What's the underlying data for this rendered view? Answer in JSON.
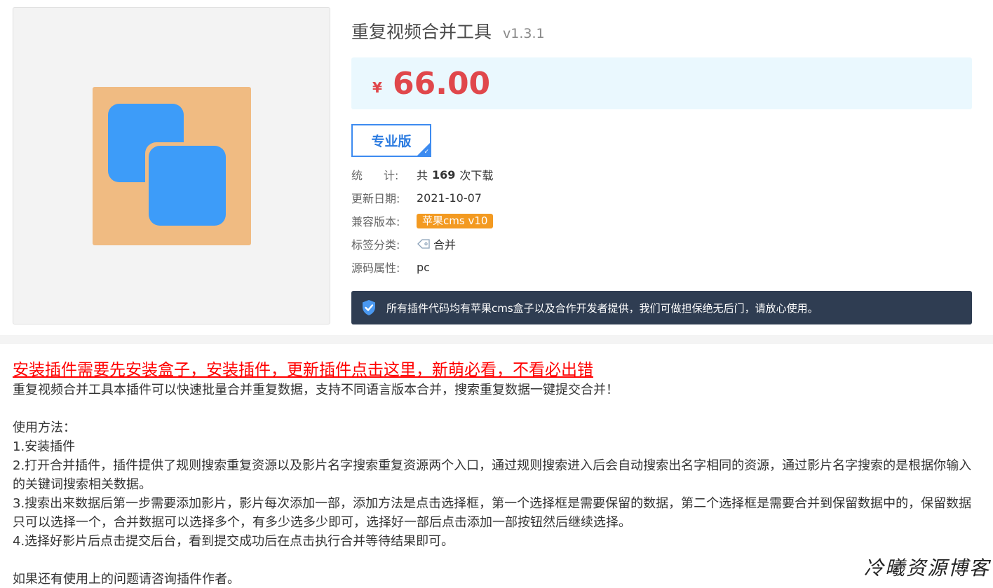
{
  "product": {
    "title": "重复视频合并工具",
    "version": "v1.3.1",
    "currency": "¥",
    "price": "66.00",
    "edition": "专业版",
    "stats": {
      "label_a": "统",
      "label_b": "计:",
      "prefix": "共",
      "count": "169",
      "suffix": "次下载"
    },
    "update_date": {
      "label": "更新日期:",
      "value": "2021-10-07"
    },
    "compat": {
      "label": "兼容版本:",
      "value": "苹果cms v10"
    },
    "tags": {
      "label": "标签分类:",
      "value": "合并"
    },
    "source": {
      "label": "源码属性:",
      "value": "pc"
    },
    "guarantee": "所有插件代码均有苹果cms盒子以及合作开发者提供，我们可做担保绝无后门，请放心使用。"
  },
  "description": {
    "install_link": "安装插件需要先安装盒子，安装插件，更新插件点击这里，新萌必看，不看必出错",
    "intro": "重复视频合并工具本插件可以快速批量合并重复数据，支持不同语言版本合并，搜索重复数据一键提交合并！",
    "usage_title": "使用方法：",
    "step1": "1.安装插件",
    "step2": "2.打开合并插件，插件提供了规则搜索重复资源以及影片名字搜索重复资源两个入口，通过规则搜索进入后会自动搜索出名字相同的资源，通过影片名字搜索的是根据你输入的关键词搜索相关数据。",
    "step3": "3.搜索出来数据后第一步需要添加影片，影片每次添加一部，添加方法是点击选择框，第一个选择框是需要保留的数据，第二个选择框是需要合并到保留数据中的，保留数据只可以选择一个，合并数据可以选择多个，有多少选多少即可，选择好一部后点击添加一部按钮然后继续选择。",
    "step4": "4.选择好影片后点击提交后台，看到提交成功后在点击执行合并等待结果即可。",
    "contact": "如果还有使用上的问题请咨询插件作者。"
  },
  "watermark": "冷曦资源博客",
  "colors": {
    "price": "#e0474b",
    "price_bg": "#eaf8fe",
    "edition_border": "#3d8bf0",
    "badge": "#f39a21",
    "guarantee_bg": "#2f3d52",
    "link": "#ff0000",
    "logo_bg": "#f0bb82",
    "logo_fg": "#3d9cf9"
  }
}
